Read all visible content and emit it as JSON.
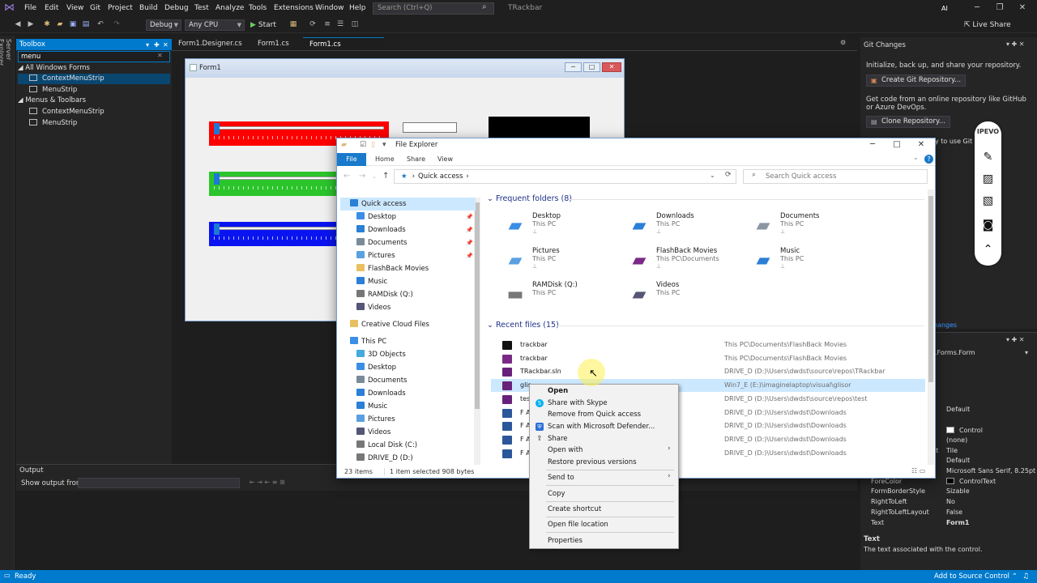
{
  "titlebar": {
    "menus": [
      "File",
      "Edit",
      "View",
      "Git",
      "Project",
      "Build",
      "Debug",
      "Test",
      "Analyze",
      "Tools",
      "Extensions",
      "Window",
      "Help"
    ],
    "search_placeholder": "Search (Ctrl+Q)",
    "solution_name": "TRackbar",
    "avatar_initials": "AI"
  },
  "toolbar": {
    "config": "Debug",
    "platform": "Any CPU",
    "start_label": "Start",
    "live_share": "Live Share"
  },
  "server_explorer": {
    "label": "Server Explorer"
  },
  "toolbox": {
    "title": "Toolbox",
    "search_value": "menu",
    "group_all": "All Windows Forms",
    "group_menus": "Menus & Toolbars",
    "items_all": [
      "ContextMenuStrip",
      "MenuStrip"
    ],
    "items_menus": [
      "ContextMenuStrip",
      "MenuStrip"
    ]
  },
  "doc_tabs": [
    "Form1.Designer.cs",
    "Form1.cs",
    "Form1.cs [Design]"
  ],
  "form": {
    "caption": "Form1"
  },
  "output": {
    "title": "Output",
    "show_from": "Show output from:"
  },
  "git": {
    "title": "Git Changes",
    "init_text": "Initialize, back up, and share your repository.",
    "create_btn": "Create Git Repository...",
    "online_text": "Get code from an online repository like GitHub or Azure DevOps.",
    "clone_btn": "Clone Repository...",
    "truncated": "y to use Git in",
    "truncated2": "udio",
    "changes_link": "hanges"
  },
  "properties": {
    "object": ".Forms.Form",
    "rows": [
      {
        "k": "",
        "v": "Default"
      },
      {
        "k": "",
        "v": "Control"
      },
      {
        "k": "",
        "v": "(none)"
      },
      {
        "k": "ut",
        "v": "Tile"
      },
      {
        "k": "",
        "v": "Default"
      },
      {
        "k": "",
        "v": "Microsoft Sans Serif, 8.25pt"
      },
      {
        "k": "ForeColor",
        "v": "ControlText"
      },
      {
        "k": "FormBorderStyle",
        "v": "Sizable"
      },
      {
        "k": "RightToLeft",
        "v": "No"
      },
      {
        "k": "RightToLeftLayout",
        "v": "False"
      },
      {
        "k": "Text",
        "v": "Form1"
      }
    ],
    "desc_title": "Text",
    "desc": "The text associated with the control."
  },
  "ipevo": {
    "label": "IPEVO"
  },
  "status": {
    "ready": "Ready",
    "source_control": "Add to Source Control"
  },
  "explorer": {
    "title": "File Explorer",
    "ribbon": {
      "file": "File",
      "home": "Home",
      "share": "Share",
      "view": "View"
    },
    "address": "Quick access",
    "search_placeholder": "Search Quick access",
    "nav": [
      {
        "label": "Quick access",
        "color": "#2b7fd6"
      },
      {
        "label": "Desktop",
        "color": "#3a8ee6"
      },
      {
        "label": "Downloads",
        "color": "#2b7fd6"
      },
      {
        "label": "Documents",
        "color": "#7a8a99"
      },
      {
        "label": "Pictures",
        "color": "#5aa0e0"
      },
      {
        "label": "FlashBack Movies",
        "color": "#e8c060"
      },
      {
        "label": "Music",
        "color": "#2b7fd6"
      },
      {
        "label": "RAMDisk (Q:)",
        "color": "#777777"
      },
      {
        "label": "Videos",
        "color": "#555577"
      },
      {
        "label": "Creative Cloud Files",
        "color": "#e8c060"
      },
      {
        "label": "This PC",
        "color": "#3a8ee6"
      },
      {
        "label": "3D Objects",
        "color": "#44aadd"
      },
      {
        "label": "Desktop",
        "color": "#3a8ee6"
      },
      {
        "label": "Documents",
        "color": "#7a8a99"
      },
      {
        "label": "Downloads",
        "color": "#2b7fd6"
      },
      {
        "label": "Music",
        "color": "#2b7fd6"
      },
      {
        "label": "Pictures",
        "color": "#5aa0e0"
      },
      {
        "label": "Videos",
        "color": "#555577"
      },
      {
        "label": "Local Disk (C:)",
        "color": "#777777"
      },
      {
        "label": "DRIVE_D (D:)",
        "color": "#777777"
      }
    ],
    "frequent_header": "Frequent folders (8)",
    "folders": [
      {
        "name": "Desktop",
        "sub": "This PC",
        "icon": "#3a8ee6"
      },
      {
        "name": "Downloads",
        "sub": "This PC",
        "icon": "#2b7fd6"
      },
      {
        "name": "Documents",
        "sub": "This PC",
        "icon": "#8a96a3"
      },
      {
        "name": "Pictures",
        "sub": "This PC",
        "icon": "#5aa0e0"
      },
      {
        "name": "FlashBack Movies",
        "sub": "This PC\\Documents",
        "icon": "#7a2a86"
      },
      {
        "name": "Music",
        "sub": "This PC",
        "icon": "#2b7fd6"
      },
      {
        "name": "RAMDisk (Q:)",
        "sub": "This PC",
        "icon": "#777777"
      },
      {
        "name": "Videos",
        "sub": "This PC",
        "icon": "#555577"
      }
    ],
    "recent_header": "Recent files (15)",
    "recent": [
      {
        "name": "trackbar",
        "path": "This PC\\Documents\\FlashBack Movies",
        "icon": "#111111"
      },
      {
        "name": "trackbar",
        "path": "This PC\\Documents\\FlashBack Movies",
        "icon": "#7a2a86"
      },
      {
        "name": "TRackbar.sln",
        "path": "DRIVE_D (D:)\\Users\\dwdst\\source\\repos\\TRackbar",
        "icon": "#68217a"
      },
      {
        "name": "glis",
        "path": "Win7_E (E:)\\imaginelaptop\\visual\\glisor",
        "icon": "#68217a"
      },
      {
        "name": "test",
        "path": "DRIVE_D (D:)\\Users\\dwdst\\source\\repos\\test",
        "icon": "#68217a"
      },
      {
        "name": "F A",
        "path": "DRIVE_D (D:)\\Users\\dwdst\\Downloads",
        "icon": "#2b579a"
      },
      {
        "name": "F A",
        "path": "DRIVE_D (D:)\\Users\\dwdst\\Downloads",
        "icon": "#2b579a"
      },
      {
        "name": "F A",
        "path": "DRIVE_D (D:)\\Users\\dwdst\\Downloads",
        "icon": "#2b579a"
      },
      {
        "name": "F A",
        "path": "DRIVE_D (D:)\\Users\\dwdst\\Downloads",
        "icon": "#2b579a"
      }
    ],
    "status_items": "23 items",
    "status_selected": "1 item selected  908 bytes"
  },
  "context_menu": {
    "open": "Open",
    "share_skype": "Share with Skype",
    "remove_qa": "Remove from Quick access",
    "scan": "Scan with Microsoft Defender...",
    "share": "Share",
    "open_with": "Open with",
    "restore": "Restore previous versions",
    "send_to": "Send to",
    "copy": "Copy",
    "create_shortcut": "Create shortcut",
    "open_location": "Open file location",
    "properties": "Properties"
  }
}
